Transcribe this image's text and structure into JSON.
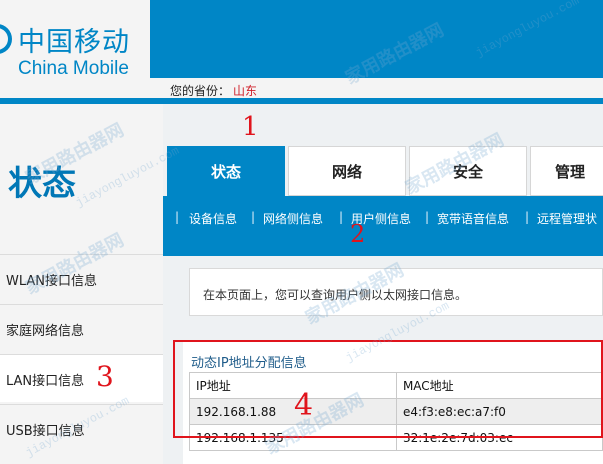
{
  "brand": {
    "name_cn": "中国移动",
    "name_en": "China Mobile"
  },
  "province": {
    "label": "您的省份：",
    "value": "山东"
  },
  "sidebar": {
    "title": "状态",
    "items": [
      {
        "label": "WLAN接口信息"
      },
      {
        "label": "家庭网络信息"
      },
      {
        "label": "LAN接口信息"
      },
      {
        "label": "USB接口信息"
      }
    ]
  },
  "tabs": [
    {
      "label": "状态"
    },
    {
      "label": "网络"
    },
    {
      "label": "安全"
    },
    {
      "label": "管理"
    }
  ],
  "subnav": {
    "items": [
      {
        "label": "设备信息"
      },
      {
        "label": "网络侧信息"
      },
      {
        "label": "用户侧信息"
      },
      {
        "label": "宽带语音信息"
      },
      {
        "label": "远程管理状"
      }
    ],
    "separator": "|"
  },
  "info_text": "在本页面上，您可以查询用户侧以太网接口信息。",
  "dhcp": {
    "title": "动态IP地址分配信息",
    "headers": [
      "IP地址",
      "MAC地址"
    ],
    "rows": [
      [
        "192.168.1.88",
        "e4:f3:e8:ec:a7:f0"
      ],
      [
        "192.168.1.135",
        "32:1e:2e:7d:03:ec"
      ]
    ]
  },
  "annotations": [
    "1",
    "2",
    "3",
    "4"
  ],
  "watermark": {
    "cn": "家用路由器网",
    "url": "jiayongluyou.com"
  },
  "colors": {
    "brand_blue": "#0086c6",
    "annotation_red": "#e0141c",
    "province_red": "#d0202a"
  }
}
